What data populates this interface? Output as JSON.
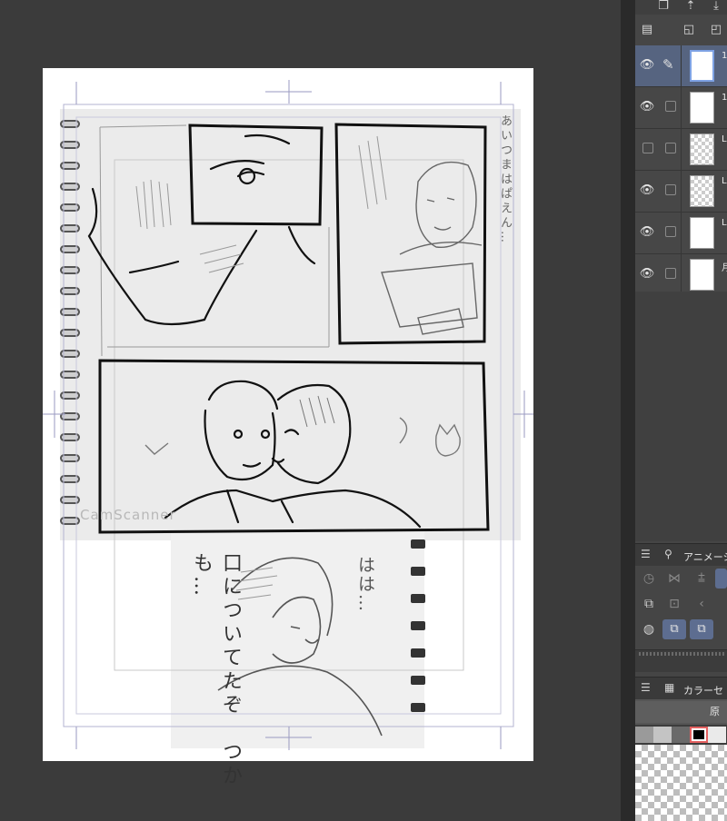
{
  "canvas": {
    "manga_text_1": "はは…",
    "manga_text_2": "口についてたぞ　つかも…",
    "manga_text_3": "あいつまはぱえん…",
    "watermark": "CamScanner"
  },
  "toolbar": {
    "icons": [
      "copy-layer-icon",
      "merge-down-icon",
      "transfer-icon"
    ],
    "row2_icons": [
      "layer-property-icon",
      "new-raster-layer-icon",
      "new-layer-folder-icon"
    ]
  },
  "layers": [
    {
      "name": "1",
      "visible": true,
      "editing": true,
      "selected": true,
      "thumbnail": "sketch"
    },
    {
      "name": "1",
      "visible": true,
      "editing": false,
      "selected": false,
      "thumbnail": "sketch"
    },
    {
      "name": "L",
      "visible": false,
      "editing": false,
      "selected": false,
      "thumbnail": "transparent"
    },
    {
      "name": "L",
      "visible": true,
      "editing": false,
      "selected": false,
      "thumbnail": "transparent"
    },
    {
      "name": "L",
      "visible": true,
      "editing": false,
      "selected": false,
      "thumbnail": "sketch"
    },
    {
      "name": "月",
      "visible": true,
      "editing": false,
      "selected": false,
      "thumbnail": "white"
    }
  ],
  "animation_panel": {
    "title": "アニメーシ"
  },
  "color_set_panel": {
    "title": "カラーセ",
    "tab_label": "原",
    "selected_color": "#000000",
    "swatches": [
      "#9a9a9a",
      "#c4c4c4",
      "#6a6a6a",
      "#000000",
      "#eaeaea"
    ]
  },
  "colors": {
    "canvas_bg": "#3b3b3b",
    "panel_bg": "#454545",
    "selection_blue": "#566480",
    "accent_button": "#5d6d90"
  }
}
